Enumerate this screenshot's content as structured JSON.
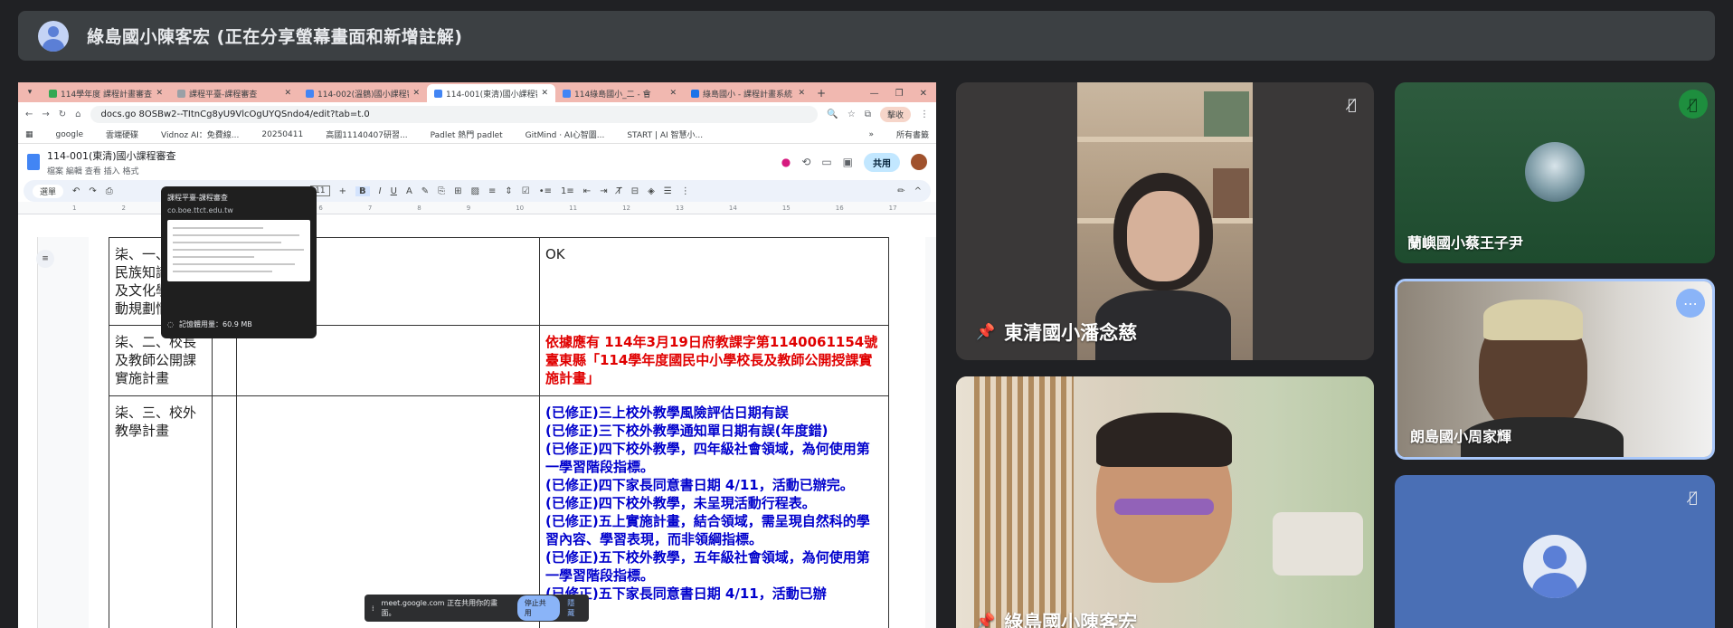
{
  "top_bar": {
    "title": "綠島國小陳客宏 (正在分享螢幕畫面和新增註解)"
  },
  "browser": {
    "tabs": [
      {
        "label": "114學年度 課程計畫審查",
        "color": "#34a853"
      },
      {
        "label": "課程平臺-課程審查",
        "color": "#9aa0a6"
      },
      {
        "label": "114-002(溫鶴)國小課程審",
        "color": "#4285f4"
      },
      {
        "label": "114-001(東清)國小課程審",
        "color": "#4285f4"
      },
      {
        "label": "114綠島國小_二 - 會",
        "color": "#4285f4"
      },
      {
        "label": "綠島國小 - 課程計畫系統",
        "color": "#1a73e8"
      }
    ],
    "url": "docs.go                                  8OSBw2--TItnCg8yU9VlcOgUYQSndo4/edit?tab=t.0",
    "profile_label": "擊收",
    "bookmarks": [
      "google",
      "雲端硬碟",
      "Vidnoz AI：免費線...",
      "20250411",
      "高國11140407研習...",
      "Padlet 熱門 padlet",
      "GitMind · AI心智圖...",
      "START | AI 智慧小...",
      "所有書籤"
    ]
  },
  "docs": {
    "title": "114-001(東清)國小課程審查",
    "menu": "檔案  編輯  查看  插入  格式",
    "share_label": "共用",
    "search_label": "選單",
    "font_size": "11"
  },
  "tooltip": {
    "title": "課程平臺-課程審查",
    "host": "co.boe.ttct.edu.tw",
    "memory": "記憶體用量：60.9 MB"
  },
  "table": {
    "rows": [
      {
        "label": "柒、一、原住民族知識課程及文化學習活動規劃情形",
        "comment": "OK",
        "style": "ok"
      },
      {
        "label": "柒、二、校長及教師公開課實施計畫",
        "comment": "依據應有 114年3月19日府教課字第1140061154號臺東縣「114學年度國民中小學校長及教師公開授課實施計畫」",
        "style": "red"
      },
      {
        "label": "柒、三、校外教學計畫",
        "comment_lines": [
          "(已修正)三上校外教學風險評估日期有誤",
          "(已修正)三下校外教學通知單日期有誤(年度錯)",
          "(已修正)四下校外教學，四年級社會領域，為何使用第一學習階段指標。",
          "(已修正)四下家長同意書日期 4/11，活動已辦完。",
          "(已修正)四下校外教學，未呈現活動行程表。",
          "(已修正)五上實施計畫，結合領域，需呈現自然科的學習內容、學習表現，而非領綱指標。",
          "(已修正)五下校外教學，五年級社會領域，為何使用第一學習階段指標。",
          "(已修正)五下家長同意書日期 4/11，活動已辦"
        ],
        "style": "blue"
      }
    ]
  },
  "share_banner": {
    "text": "meet.google.com 正在共用你的畫面。",
    "stop_label": "停止共用",
    "hide_label": "隱藏"
  },
  "participants": [
    {
      "name": "東清國小潘念慈",
      "pinned": true
    },
    {
      "name": "蘭嶼國小蔡王子尹",
      "pinned": false
    },
    {
      "name": "朗島國小周家輝",
      "pinned": false
    },
    {
      "name": "綠島國小陳客宏",
      "pinned": true
    }
  ]
}
